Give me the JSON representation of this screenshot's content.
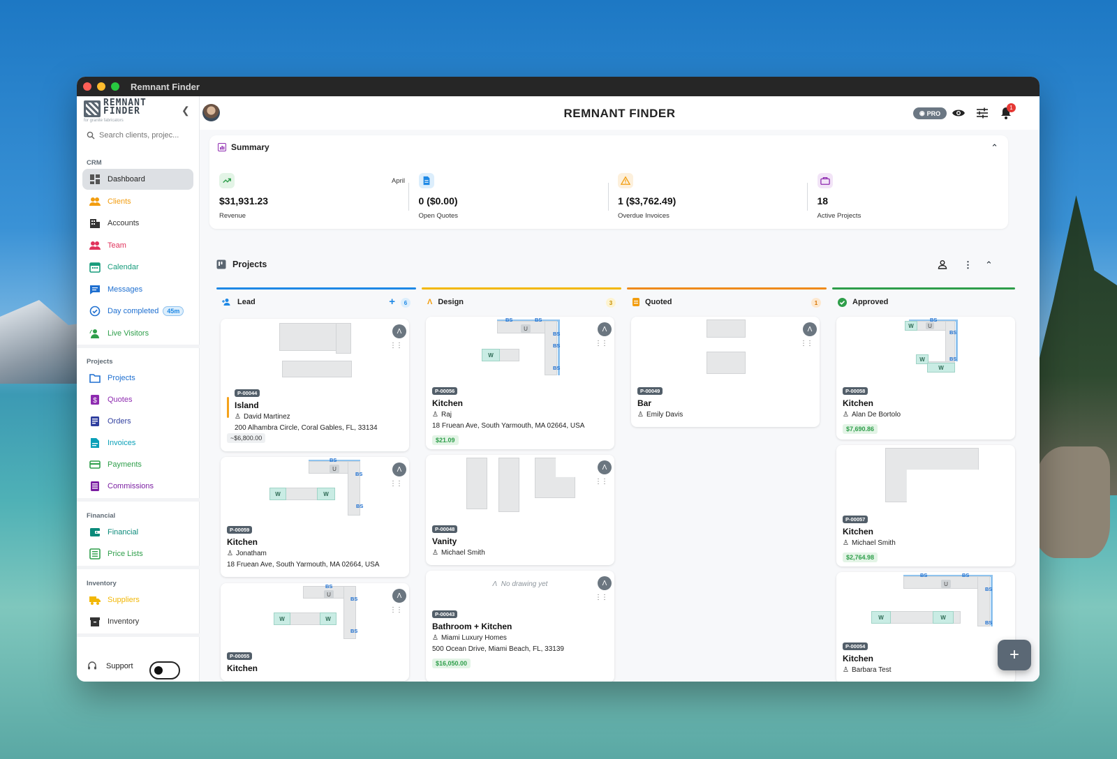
{
  "window": {
    "title": "Remnant Finder"
  },
  "sidebar": {
    "logo_text": "REMNANT\nFINDER",
    "logo_tagline": "for granite fabricators",
    "search_placeholder": "Search clients, projec...",
    "sections": {
      "crm": "CRM",
      "projects": "Projects",
      "financial": "Financial",
      "inventory": "Inventory"
    },
    "crm_items": [
      {
        "label": "Dashboard",
        "color": "#333333",
        "icon": "dashboard-icon"
      },
      {
        "label": "Clients",
        "color": "#f29d0f",
        "icon": "people-icon"
      },
      {
        "label": "Accounts",
        "color": "#333333",
        "icon": "building-icon"
      },
      {
        "label": "Team",
        "color": "#e0335c",
        "icon": "team-icon"
      },
      {
        "label": "Calendar",
        "color": "#179c7c",
        "icon": "calendar-icon"
      },
      {
        "label": "Messages",
        "color": "#1e6fd0",
        "icon": "chat-icon"
      },
      {
        "label": "Day completed",
        "color": "#1e6fd0",
        "icon": "check-circle-icon",
        "badge": "45m"
      },
      {
        "label": "Live Visitors",
        "color": "#2e9e4a",
        "icon": "visitors-icon"
      }
    ],
    "project_items": [
      {
        "label": "Projects",
        "color": "#1e6fd0",
        "icon": "folder-icon"
      },
      {
        "label": "Quotes",
        "color": "#8e2bb0",
        "icon": "dollar-doc-icon"
      },
      {
        "label": "Orders",
        "color": "#303f9f",
        "icon": "orders-icon"
      },
      {
        "label": "Invoices",
        "color": "#0aa0b8",
        "icon": "invoice-icon"
      },
      {
        "label": "Payments",
        "color": "#2e9e4a",
        "icon": "card-icon"
      },
      {
        "label": "Commissions",
        "color": "#7b1fa2",
        "icon": "commission-icon"
      }
    ],
    "financial_items": [
      {
        "label": "Financial",
        "color": "#0a8a7a",
        "icon": "wallet-icon"
      },
      {
        "label": "Price Lists",
        "color": "#2e9e4a",
        "icon": "list-icon"
      }
    ],
    "inventory_items": [
      {
        "label": "Suppliers",
        "color": "#f2b705",
        "icon": "truck-icon"
      },
      {
        "label": "Inventory",
        "color": "#333333",
        "icon": "box-icon"
      }
    ],
    "support_label": "Support"
  },
  "header": {
    "title": "REMNANT FINDER",
    "pro_label": "PRO",
    "notification_count": "1"
  },
  "summary": {
    "title": "Summary",
    "stats": [
      {
        "value": "$31,931.23",
        "label": "Revenue",
        "extra": "April",
        "icon": "trend-up-icon",
        "color": "#2e9e4a",
        "bg": "#e3f4e6"
      },
      {
        "value": "0 ($0.00)",
        "label": "Open Quotes",
        "icon": "document-icon",
        "color": "#1e88e5",
        "bg": "#dceefc"
      },
      {
        "value": "1 ($3,762.49)",
        "label": "Overdue Invoices",
        "icon": "warning-icon",
        "color": "#f29d0f",
        "bg": "#fdf0dc"
      },
      {
        "value": "18",
        "label": "Active Projects",
        "icon": "briefcase-icon",
        "color": "#8e2bb0",
        "bg": "#f2e4f7"
      }
    ]
  },
  "projects": {
    "title": "Projects",
    "columns": [
      {
        "name": "Lead",
        "count": "6",
        "color": "#1e88e5",
        "cnt_bg": "#dceefc",
        "cnt_fg": "#1e88e5"
      },
      {
        "name": "Design",
        "count": "3",
        "color": "#f2b705",
        "cnt_bg": "#fdf3d0",
        "cnt_fg": "#c88f00"
      },
      {
        "name": "Quoted",
        "count": "1",
        "color": "#ef8a1a",
        "cnt_bg": "#fde8cf",
        "cnt_fg": "#d57400"
      },
      {
        "name": "Approved",
        "color": "#2e9e4a"
      }
    ],
    "cards": {
      "lead": [
        {
          "id": "P-00044",
          "title": "Island",
          "client": "David Martinez",
          "address": "200 Alhambra Circle, Coral Gables, FL, 33134",
          "price": "~$6,800.00"
        },
        {
          "id": "P-00059",
          "title": "Kitchen",
          "client": "Jonatham",
          "address": "18 Fruean Ave, South Yarmouth, MA 02664, USA"
        },
        {
          "id": "P-00055",
          "title": "Kitchen"
        }
      ],
      "design": [
        {
          "id": "P-00056",
          "title": "Kitchen",
          "client": "Raj",
          "address": "18 Fruean Ave, South Yarmouth, MA 02664, USA",
          "price": "$21.09"
        },
        {
          "id": "P-00048",
          "title": "Vanity",
          "client": "Michael Smith"
        },
        {
          "id": "P-00043",
          "title": "Bathroom + Kitchen",
          "client": "Miami Luxury Homes",
          "address": "500 Ocean Drive, Miami Beach, FL, 33139",
          "price": "$16,050.00",
          "no_drawing": "No drawing yet"
        }
      ],
      "quoted": [
        {
          "id": "P-00049",
          "title": "Bar",
          "client": "Emily Davis"
        }
      ],
      "approved": [
        {
          "id": "P-00058",
          "title": "Kitchen",
          "client": "Alan De Bortolo",
          "price": "$7,690.86"
        },
        {
          "id": "P-00057",
          "title": "Kitchen",
          "client": "Michael Smith",
          "price": "$2,764.98"
        },
        {
          "id": "P-00054",
          "title": "Kitchen",
          "client": "Barbara Test"
        }
      ]
    },
    "drawing_labels": {
      "bs": "BS",
      "u": "U",
      "w": "W"
    }
  }
}
